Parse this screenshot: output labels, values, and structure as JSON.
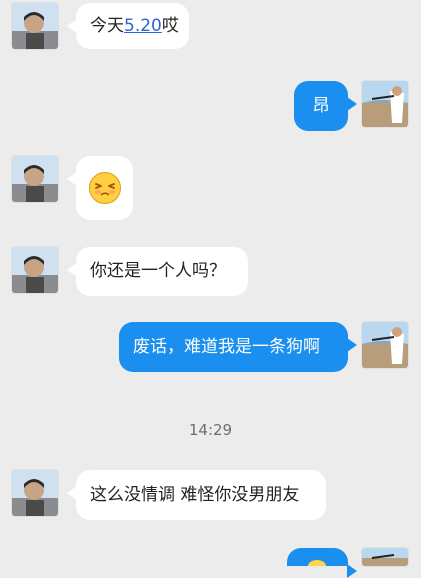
{
  "messages": [
    {
      "direction": "in",
      "text_parts": [
        "今天",
        "5.20",
        "哎"
      ]
    },
    {
      "direction": "out",
      "text": "昂"
    },
    {
      "direction": "in",
      "emoji": "face-with-closed-eyes-emoji"
    },
    {
      "direction": "in",
      "text": "你还是一个人吗？"
    },
    {
      "direction": "out",
      "text": "废话，难道我是一条狗啊"
    },
    {
      "direction": "in",
      "text": "这么没情调 难怪你没男朋友"
    },
    {
      "direction": "out",
      "emoji": "emoji-partial"
    }
  ],
  "timestamp": "14:29",
  "colors": {
    "background": "#ececec",
    "incoming_bubble": "#ffffff",
    "outgoing_bubble": "#1a8ff0",
    "link": "#2b67d8",
    "timestamp": "#6d6d6d"
  }
}
